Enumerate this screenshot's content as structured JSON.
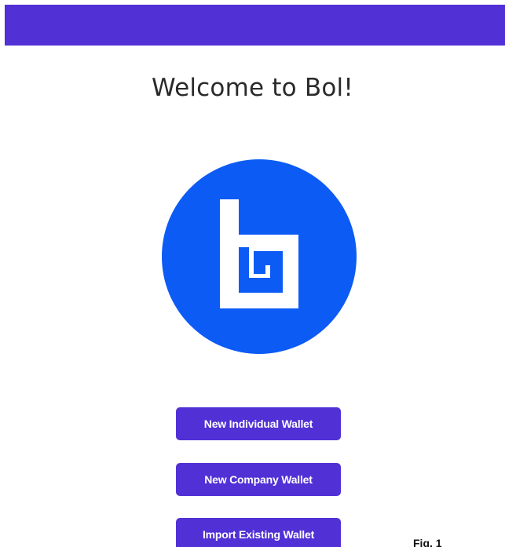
{
  "header": {
    "bar_color": "#5130d5"
  },
  "main": {
    "title": "Welcome to Bol!",
    "logo": {
      "icon": "bol-logo-icon",
      "circle_color": "#0d5bf5",
      "mark_color": "#ffffff"
    },
    "buttons": [
      {
        "label": "New Individual Wallet"
      },
      {
        "label": "New Company Wallet"
      },
      {
        "label": "Import Existing Wallet"
      }
    ],
    "button_color": "#5130d5"
  },
  "caption": {
    "label": "Fig. 1"
  }
}
